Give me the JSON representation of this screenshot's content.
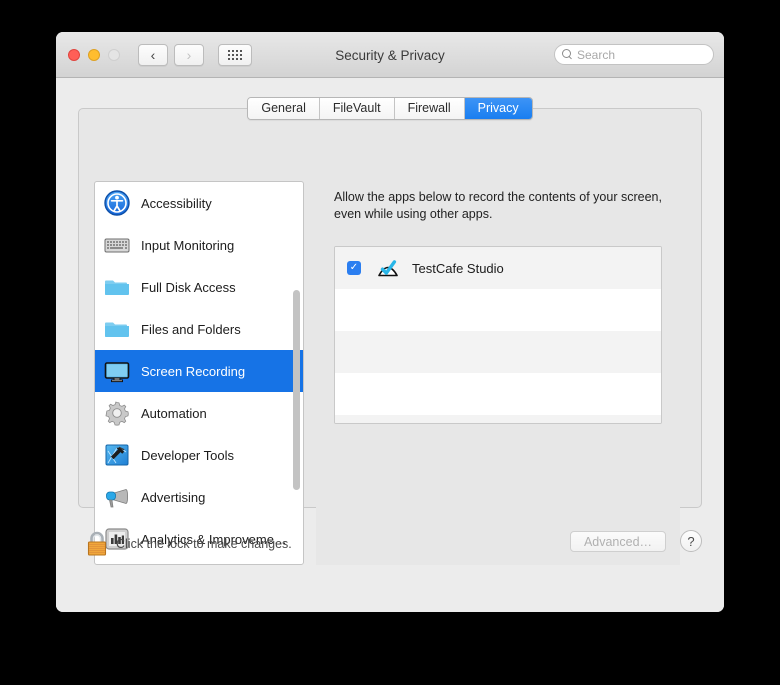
{
  "window": {
    "title": "Security & Privacy",
    "traffic_lights": [
      {
        "name": "close",
        "color": "#ff5f57"
      },
      {
        "name": "minimize",
        "color": "#ffbd2e"
      },
      {
        "name": "zoom",
        "color": "#e4e4e4",
        "disabled": true
      }
    ],
    "nav": {
      "back": "‹",
      "forward": "›",
      "grid_icon": "show-all-grid-icon"
    }
  },
  "search": {
    "placeholder": "Search",
    "value": "",
    "icon": "search-icon"
  },
  "tabs": [
    {
      "label": "General",
      "active": false
    },
    {
      "label": "FileVault",
      "active": false
    },
    {
      "label": "Firewall",
      "active": false
    },
    {
      "label": "Privacy",
      "active": true
    }
  ],
  "sidebar": {
    "items": [
      {
        "label": "Accessibility",
        "icon": "accessibility-icon",
        "selected": false
      },
      {
        "label": "Input Monitoring",
        "icon": "keyboard-icon",
        "selected": false
      },
      {
        "label": "Full Disk Access",
        "icon": "folder-icon",
        "selected": false
      },
      {
        "label": "Files and Folders",
        "icon": "folder-icon",
        "selected": false
      },
      {
        "label": "Screen Recording",
        "icon": "display-icon",
        "selected": true
      },
      {
        "label": "Automation",
        "icon": "gear-icon",
        "selected": false
      },
      {
        "label": "Developer Tools",
        "icon": "hammer-blueprint-icon",
        "selected": false
      },
      {
        "label": "Advertising",
        "icon": "megaphone-icon",
        "selected": false
      },
      {
        "label": "Analytics & Improveme…",
        "icon": "bar-chart-icon",
        "selected": false
      }
    ]
  },
  "main": {
    "description": "Allow the apps below to record the contents of your screen, even while using other apps.",
    "apps": [
      {
        "name": "TestCafe Studio",
        "checked": true,
        "icon": "testcafe-studio-icon"
      }
    ],
    "empty_row_count": 4
  },
  "footer": {
    "lock_icon": "lock-closed-icon",
    "lock_text": "Click the lock to make changes.",
    "advanced_label": "Advanced…",
    "advanced_disabled": true,
    "help_label": "?"
  },
  "colors": {
    "accent": "#1673e6",
    "tab_active": "#1a7ef0",
    "checkbox": "#2b7ef0",
    "window_bg": "#ececec"
  }
}
